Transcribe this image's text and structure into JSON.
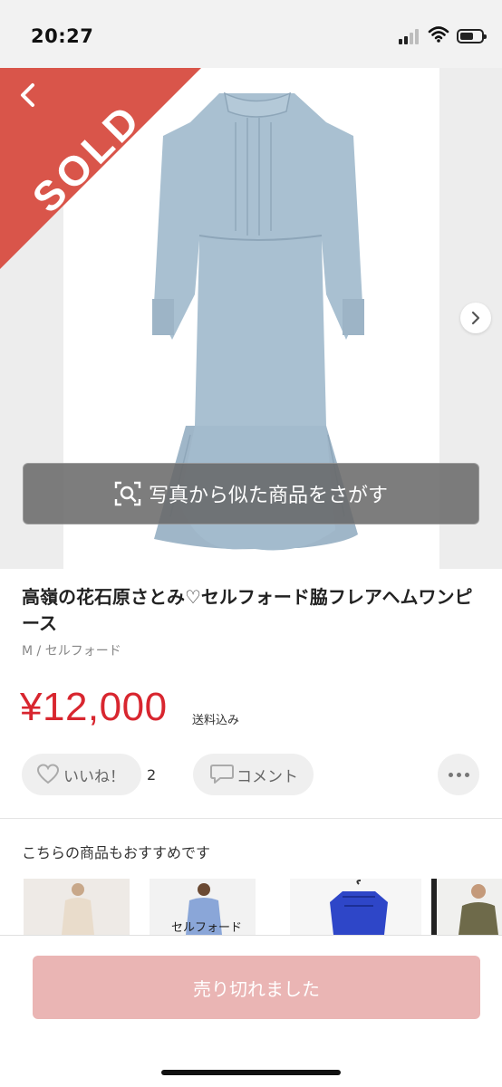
{
  "status_bar": {
    "time": "20:27"
  },
  "photo": {
    "sold_badge": "SOLD",
    "search_label": "写真から似た商品をさがす",
    "colors": {
      "badge": "#d9554a",
      "dress": "#a9c0d1"
    }
  },
  "product": {
    "title": "高嶺の花石原さとみ♡セルフォード脇フレアヘムワンピース",
    "subtitle": "M / セルフォード",
    "price": "¥12,000",
    "shipping": "送料込み"
  },
  "actions": {
    "like_label": "いいね！",
    "like_count": "2",
    "comment_label": "コメント"
  },
  "recommendations": {
    "title": "こちらの商品もおすすめです",
    "items": [
      {
        "caption": ""
      },
      {
        "caption": "セルフォード"
      },
      {
        "caption": ""
      },
      {
        "caption": ""
      }
    ]
  },
  "bottom": {
    "soldout_label": "売り切れました"
  },
  "theme": {
    "price_color": "#d8262f",
    "soldout_button": "#eab5b4"
  }
}
